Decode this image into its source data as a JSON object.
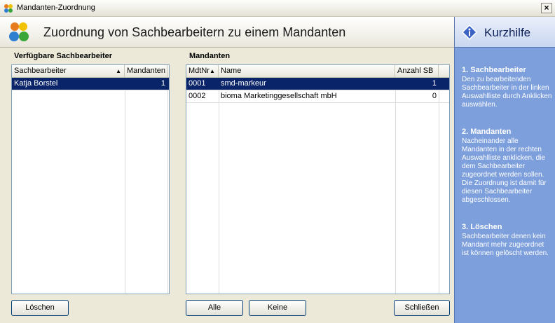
{
  "window": {
    "title": "Mandanten-Zuordnung",
    "close_label": "×"
  },
  "header": {
    "title": "Zuordnung von Sachbearbeitern zu einem Mandanten"
  },
  "left": {
    "label": "Verfügbare Sachbearbeiter",
    "columns": [
      "Sachbearbeiter",
      "Mandanten"
    ],
    "rows": [
      {
        "name": "Katja Borstel",
        "count": "1",
        "selected": true
      }
    ]
  },
  "right": {
    "label": "Mandanten",
    "columns": [
      "MdtNr",
      "Name",
      "Anzahl SB"
    ],
    "rows": [
      {
        "nr": "0001",
        "name": "smd-markeur",
        "count": "1",
        "selected": true
      },
      {
        "nr": "0002",
        "name": "bioma Marketinggesellschaft mbH",
        "count": "0",
        "selected": false
      }
    ]
  },
  "buttons": {
    "delete": "Löschen",
    "all": "Alle",
    "none": "Keine",
    "close": "Schließen"
  },
  "help": {
    "title": "Kurzhilfe",
    "sections": [
      {
        "title": "1. Sachbearbeiter",
        "text": "Den zu bearbeitenden Sachbearbeiter in der linken Auswahlliste durch Anklicken auswählen."
      },
      {
        "title": "2. Mandanten",
        "text": "Nacheinander alle Mandanten in der rechten Auswahlliste anklicken, die dem Sachbearbeiter zugeordnet werden sollen. Die Zuordnung ist damit für diesen Sachbearbeiter abgeschlossen."
      },
      {
        "title": "3. Löschen",
        "text": "Sachbearbeiter denen kein Mandant mehr zugeordnet ist können gelöscht werden."
      }
    ]
  }
}
